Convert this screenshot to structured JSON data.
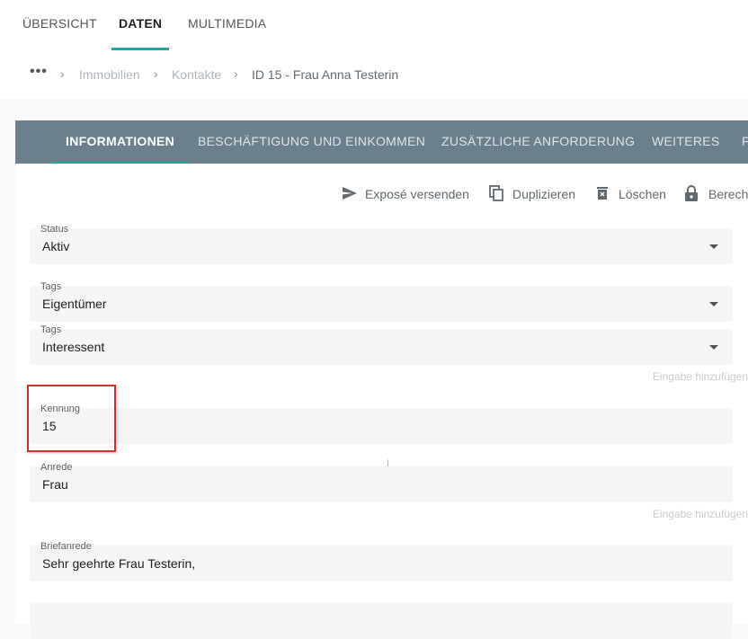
{
  "top_tabs": [
    {
      "label": "ÜBERSICHT"
    },
    {
      "label": "DATEN"
    },
    {
      "label": "MULTIMEDIA"
    }
  ],
  "breadcrumb": {
    "more": "•••",
    "items": [
      "Immobilien",
      "Kontakte"
    ],
    "current": "ID 15 - Frau Anna Testerin"
  },
  "sub_tabs": [
    {
      "label": "INFORMATIONEN"
    },
    {
      "label": "BESCHÄFTIGUNG UND EINKOMMEN"
    },
    {
      "label": "ZUSÄTZLICHE ANFORDERUNG"
    },
    {
      "label": "WEITERES"
    },
    {
      "label": "F"
    }
  ],
  "actions": {
    "send_expose": "Exposé versenden",
    "duplicate": "Duplizieren",
    "delete": "Löschen",
    "permissions": "Berech"
  },
  "fields": {
    "status": {
      "label": "Status",
      "value": "Aktiv"
    },
    "tags1": {
      "label": "Tags",
      "value": "Eigentümer"
    },
    "tags2": {
      "label": "Tags",
      "value": "Interessent"
    },
    "kennung": {
      "label": "Kennung",
      "value": "15"
    },
    "anrede": {
      "label": "Anrede",
      "value": "Frau"
    },
    "briefanrede": {
      "label": "Briefanrede",
      "value": "Sehr geehrte Frau Testerin,"
    }
  },
  "hints": {
    "add_entry_1": "Eingabe hinzufügen",
    "add_entry_2": "Eingabe hinzufügen"
  },
  "colors": {
    "accent": "#26a69a",
    "tabbar": "#6b808d",
    "highlight": "#d32f2f"
  }
}
